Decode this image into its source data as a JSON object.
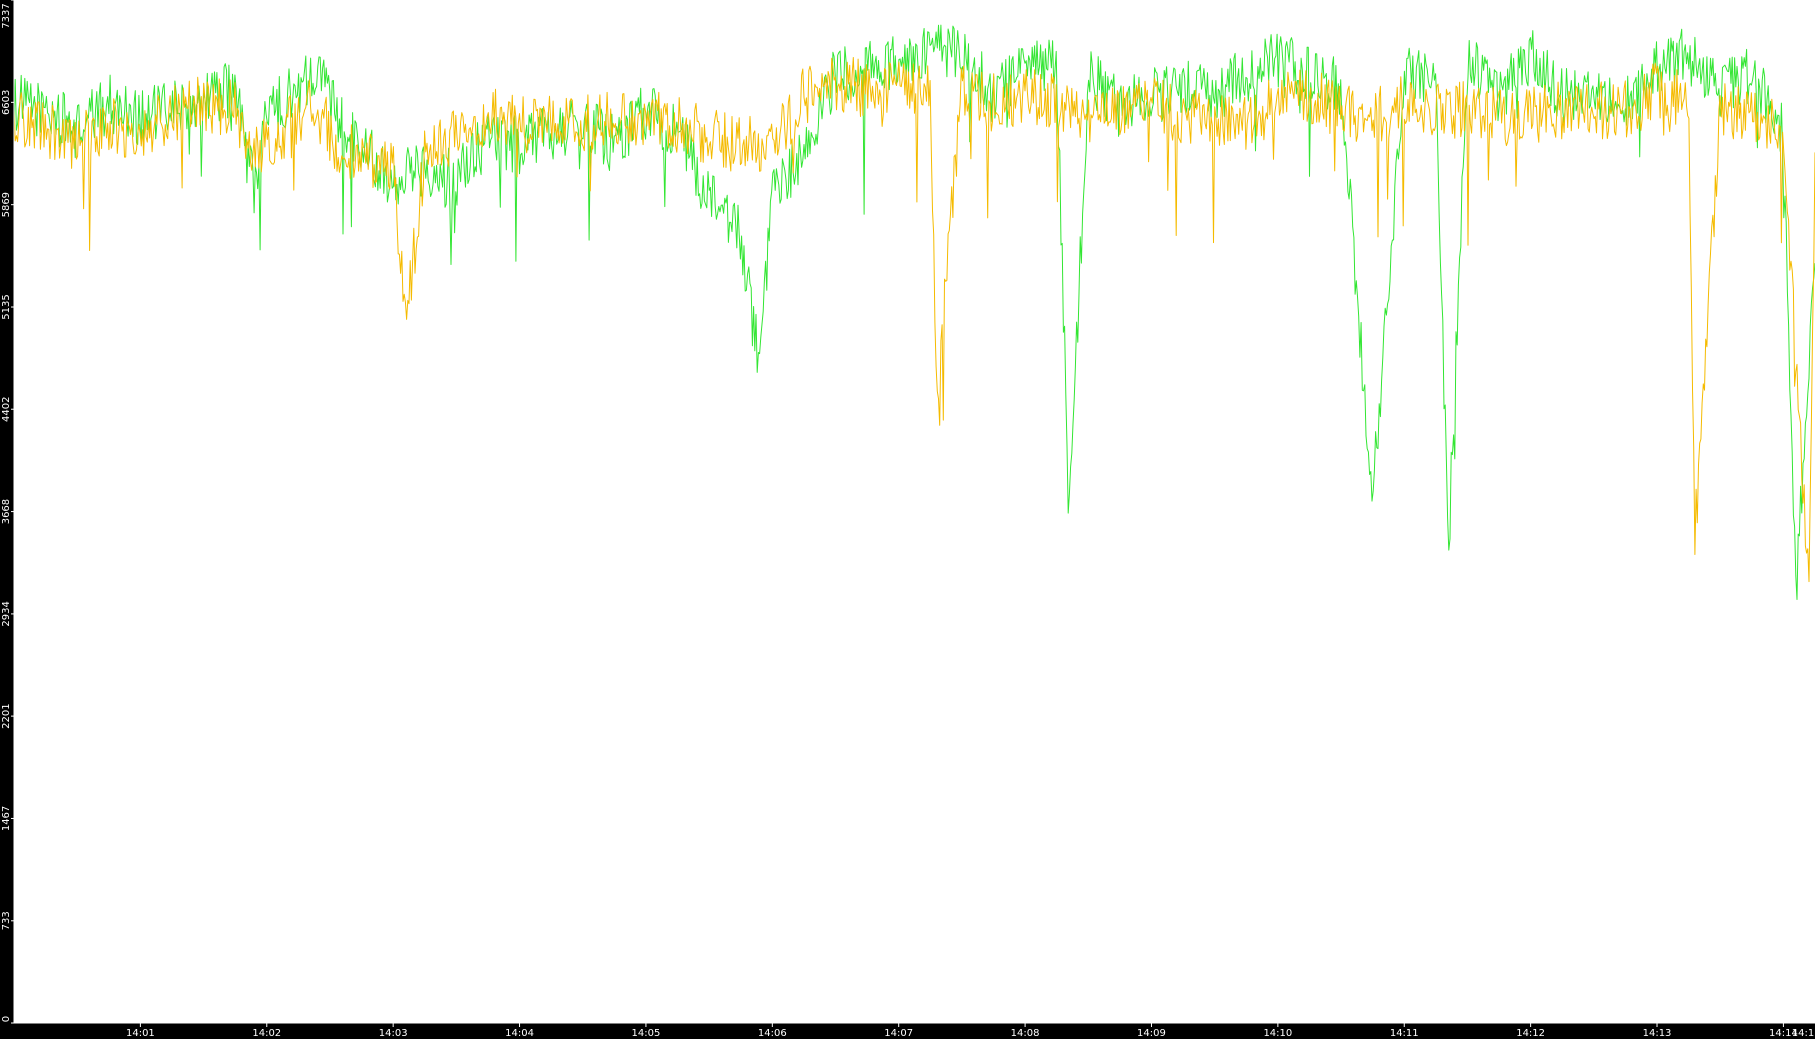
{
  "chart_data": {
    "type": "line",
    "title": "",
    "xlabel": "",
    "ylabel": "",
    "background": "#000000",
    "plot_background": "#ffffff",
    "axis_color": "#ffffff",
    "grid": false,
    "legend": "none",
    "ylim": [
      0,
      7337
    ],
    "xlim_minutes": [
      0,
      14.25
    ],
    "y_ticks": [
      {
        "value": 0,
        "label": "0"
      },
      {
        "value": 733,
        "label": "733"
      },
      {
        "value": 1467,
        "label": "1467"
      },
      {
        "value": 2201,
        "label": "2201"
      },
      {
        "value": 2934,
        "label": "2934"
      },
      {
        "value": 3668,
        "label": "3668"
      },
      {
        "value": 4402,
        "label": "4402"
      },
      {
        "value": 5135,
        "label": "5135"
      },
      {
        "value": 5869,
        "label": "5869"
      },
      {
        "value": 6603,
        "label": "6603"
      },
      {
        "value": 7337,
        "label": "7337"
      }
    ],
    "x_ticks": [
      {
        "value": 1,
        "label": "14:01"
      },
      {
        "value": 2,
        "label": "14:02"
      },
      {
        "value": 3,
        "label": "14:03"
      },
      {
        "value": 4,
        "label": "14:04"
      },
      {
        "value": 5,
        "label": "14:05"
      },
      {
        "value": 6,
        "label": "14:06"
      },
      {
        "value": 7,
        "label": "14:07"
      },
      {
        "value": 8,
        "label": "14:08"
      },
      {
        "value": 9,
        "label": "14:09"
      },
      {
        "value": 10,
        "label": "14:10"
      },
      {
        "value": 11,
        "label": "14:11"
      },
      {
        "value": 12,
        "label": "14:12"
      },
      {
        "value": 13,
        "label": "14:13"
      },
      {
        "value": 14,
        "label": "14:14"
      },
      {
        "value": 15,
        "label": "14:1"
      }
    ],
    "series": [
      {
        "color": "#33e633",
        "x": [
          0.0,
          0.25,
          0.5,
          0.75,
          1.0,
          1.25,
          1.5,
          1.75,
          1.9,
          2.0,
          2.25,
          2.4,
          2.5,
          2.75,
          3.0,
          3.25,
          3.5,
          3.75,
          4.0,
          4.25,
          4.5,
          4.75,
          5.0,
          5.25,
          5.5,
          5.75,
          5.9,
          6.0,
          6.25,
          6.5,
          6.75,
          7.0,
          7.25,
          7.5,
          7.75,
          8.0,
          8.25,
          8.35,
          8.5,
          8.75,
          9.0,
          9.25,
          9.5,
          9.75,
          10.0,
          10.25,
          10.5,
          10.75,
          11.0,
          11.25,
          11.35,
          11.5,
          11.75,
          12.0,
          12.25,
          12.5,
          12.75,
          13.0,
          13.25,
          13.5,
          13.75,
          14.0,
          14.1,
          14.25
        ],
        "y": [
          6600,
          6550,
          6400,
          6600,
          6500,
          6550,
          6650,
          6700,
          6000,
          6500,
          6700,
          6900,
          6600,
          6300,
          6050,
          6150,
          6050,
          6350,
          6300,
          6400,
          6450,
          6300,
          6550,
          6400,
          5900,
          5650,
          4700,
          5900,
          6250,
          6800,
          6850,
          6900,
          6950,
          6950,
          6650,
          6900,
          6850,
          3600,
          6800,
          6550,
          6650,
          6700,
          6650,
          6800,
          6900,
          6800,
          6700,
          3800,
          6800,
          6750,
          3400,
          6900,
          6650,
          6950,
          6650,
          6700,
          6600,
          6850,
          6950,
          6700,
          6800,
          6400,
          3100,
          5400
        ]
      },
      {
        "color": "#f5bb00",
        "x": [
          0.0,
          0.25,
          0.5,
          0.75,
          1.0,
          1.25,
          1.5,
          1.75,
          1.9,
          2.0,
          2.25,
          2.4,
          2.5,
          2.75,
          3.0,
          3.1,
          3.25,
          3.5,
          3.75,
          4.0,
          4.25,
          4.5,
          4.75,
          5.0,
          5.25,
          5.5,
          5.75,
          6.0,
          6.25,
          6.5,
          6.75,
          7.0,
          7.25,
          7.3,
          7.5,
          7.75,
          8.0,
          8.25,
          8.5,
          8.75,
          9.0,
          9.25,
          9.5,
          9.75,
          10.0,
          10.25,
          10.5,
          10.75,
          11.0,
          11.25,
          11.5,
          11.75,
          12.0,
          12.25,
          12.5,
          12.75,
          13.0,
          13.25,
          13.3,
          13.5,
          13.75,
          14.0,
          14.2,
          14.25
        ],
        "y": [
          6500,
          6400,
          6300,
          6450,
          6350,
          6550,
          6600,
          6550,
          6200,
          6300,
          6500,
          6650,
          6350,
          6200,
          6150,
          5000,
          6200,
          6400,
          6500,
          6450,
          6450,
          6450,
          6500,
          6500,
          6450,
          6350,
          6300,
          6300,
          6650,
          6750,
          6700,
          6750,
          6650,
          4500,
          6700,
          6600,
          6650,
          6600,
          6500,
          6550,
          6600,
          6500,
          6450,
          6450,
          6600,
          6650,
          6550,
          6500,
          6600,
          6550,
          6550,
          6500,
          6500,
          6550,
          6550,
          6550,
          6700,
          6600,
          3500,
          6550,
          6500,
          6400,
          3100,
          6100
        ]
      }
    ]
  }
}
